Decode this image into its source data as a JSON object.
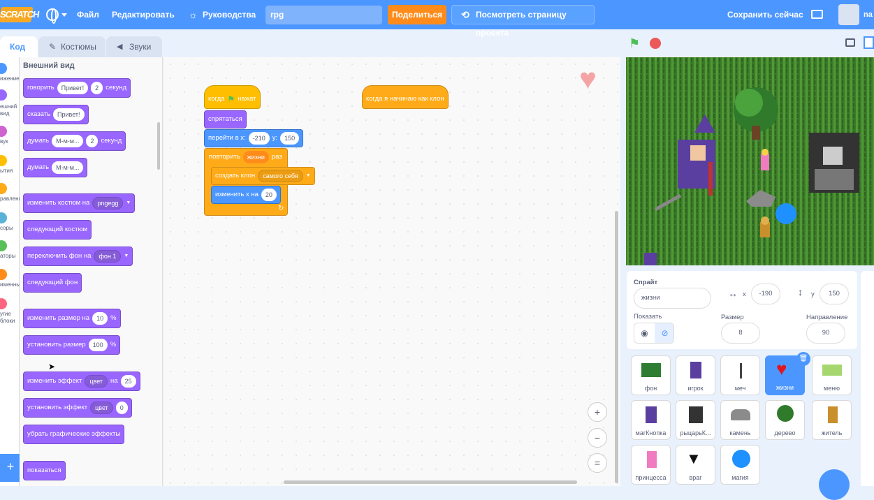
{
  "menubar": {
    "logo": "SCRATCH",
    "file": "Файл",
    "edit": "Редактировать",
    "tutorials": "Руководства",
    "project_title": "rpg",
    "share": "Поделиться",
    "see_project": "Посмотреть страницу проекта",
    "save_now": "Сохранить сейчас",
    "username": "na"
  },
  "tabs": {
    "code": "Код",
    "costumes": "Костюмы",
    "sounds": "Звуки"
  },
  "categories": [
    {
      "label": "ижение",
      "color": "#4c97ff"
    },
    {
      "label": "ешний вид",
      "color": "#9966ff"
    },
    {
      "label": "вук",
      "color": "#cf63cf"
    },
    {
      "label": "ытия",
      "color": "#ffbf00"
    },
    {
      "label": "равление",
      "color": "#ffab19"
    },
    {
      "label": "соры",
      "color": "#5cb1d6"
    },
    {
      "label": "аторы",
      "color": "#59c059"
    },
    {
      "label": "именные",
      "color": "#ff8c1a"
    },
    {
      "label": "угие блоки",
      "color": "#ff6680"
    }
  ],
  "palette": {
    "heading": "Внешний вид",
    "say_secs": {
      "a": "говорить",
      "b": "Привет!",
      "c": "2",
      "d": "секунд"
    },
    "say": {
      "a": "сказать",
      "b": "Привет!"
    },
    "think_secs": {
      "a": "думать",
      "b": "М-м-м...",
      "c": "2",
      "d": "секунд"
    },
    "think": {
      "a": "думать",
      "b": "М-м-м..."
    },
    "switch_costume": {
      "a": "изменить костюм на",
      "b": "pngegg"
    },
    "next_costume": "следующий костюм",
    "switch_backdrop": {
      "a": "переключить фон на",
      "b": "фон 1"
    },
    "next_backdrop": "следующий фон",
    "change_size": {
      "a": "изменить размер на",
      "b": "10",
      "c": "%"
    },
    "set_size": {
      "a": "установить размер",
      "b": "100",
      "c": "%"
    },
    "change_effect": {
      "a": "изменить эффект",
      "b": "цвет",
      "c": "на",
      "d": "25"
    },
    "set_effect": {
      "a": "установить эффект",
      "b": "цвет",
      "c": "0"
    },
    "clear_effects": "убрать графические эффекты",
    "show": "показаться"
  },
  "script": {
    "when_flag": "когда",
    "clicked": "нажат",
    "hide": "спрятаться",
    "goto": "перейти в x:",
    "x": "-210",
    "ylbl": "y:",
    "y": "150",
    "repeat": "повторить",
    "repeat_var": "жизни",
    "times": "раз",
    "create_clone": "создать клон",
    "clone_of": "самого себя",
    "change_x": "изменить x на",
    "change_x_val": "20",
    "when_clone": "когда я начинаю как клон"
  },
  "zoom": {
    "in": "+",
    "out": "−",
    "reset": "="
  },
  "sprite_info": {
    "sprite_label": "Спрайт",
    "sprite_name": "жизни",
    "x_label": "x",
    "x": "-190",
    "y_label": "y",
    "y": "150",
    "show_label": "Показать",
    "size_label": "Размер",
    "size": "8",
    "direction_label": "Направление",
    "direction": "90"
  },
  "sprites": [
    "фон",
    "игрок",
    "меч",
    "жизни",
    "меню",
    "магКнопка",
    "рыцарьК...",
    "камень",
    "дерево",
    "житель",
    "принцесса",
    "враг",
    "магия"
  ]
}
